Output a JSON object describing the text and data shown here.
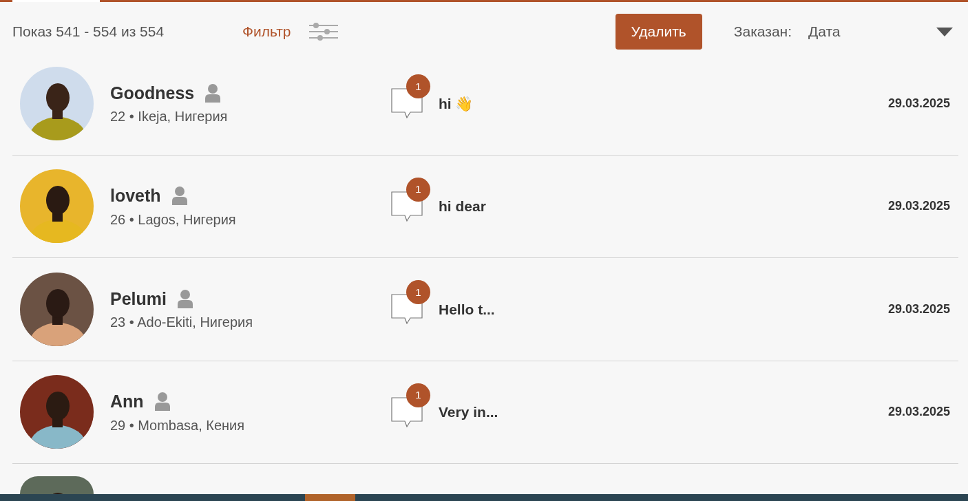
{
  "toolbar": {
    "count_text": "Показ 541 - 554 из 554",
    "filter_label": "Фильтр",
    "delete_button": "Удалить",
    "sort_label": "Заказан:",
    "sort_value": "Дата"
  },
  "rows": [
    {
      "kind": "full",
      "name": "Goodness",
      "details": "22 • Ikeja, Нигерия",
      "unread": "1",
      "message": "hi 👋",
      "date": "29.03.2025"
    },
    {
      "kind": "full",
      "name": "loveth",
      "details": "26 • Lagos, Нигерия",
      "unread": "1",
      "message": "hi dear",
      "date": "29.03.2025"
    },
    {
      "kind": "full",
      "name": "Pelumi",
      "details": "23 • Ado-Ekiti, Нигерия",
      "unread": "1",
      "message": "Hello t...",
      "date": "29.03.2025"
    },
    {
      "kind": "full",
      "name": "Ann",
      "details": "29 • Mombasa, Кения",
      "unread": "1",
      "message": "Very in...",
      "date": "29.03.2025"
    },
    {
      "kind": "partial"
    }
  ]
}
